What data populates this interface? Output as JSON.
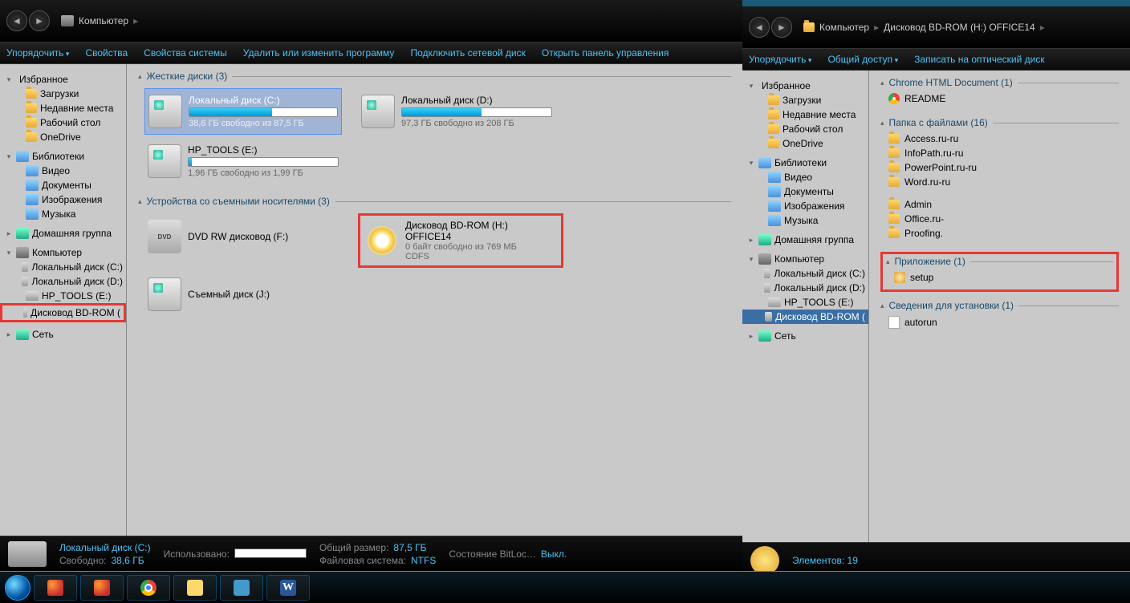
{
  "win1": {
    "breadcrumb": [
      "Компьютер"
    ],
    "toolbar": [
      "Упорядочить",
      "Свойства",
      "Свойства системы",
      "Удалить или изменить программу",
      "Подключить сетевой диск",
      "Открыть панель управления"
    ],
    "sidebar": {
      "fav_head": "Избранное",
      "fav": [
        "Загрузки",
        "Недавние места",
        "Рабочий стол",
        "OneDrive"
      ],
      "lib_head": "Библиотеки",
      "lib": [
        "Видео",
        "Документы",
        "Изображения",
        "Музыка"
      ],
      "home": "Домашняя группа",
      "comp_head": "Компьютер",
      "comp": [
        "Локальный диск (C:)",
        "Локальный диск (D:)",
        "HP_TOOLS (E:)",
        "Дисковод BD-ROM ("
      ],
      "net": "Сеть"
    },
    "groups": {
      "hdd_head": "Жесткие диски (3)",
      "dev_head": "Устройства со съемными носителями (3)"
    },
    "drives": [
      {
        "name": "Локальный диск (C:)",
        "free": "38,6 ГБ свободно из 87,5 ГБ",
        "pct": 56,
        "sel": true
      },
      {
        "name": "Локальный диск (D:)",
        "free": "97,3 ГБ свободно из 208 ГБ",
        "pct": 53
      },
      {
        "name": "HP_TOOLS (E:)",
        "free": "1,96 ГБ свободно из 1,99 ГБ",
        "pct": 2
      }
    ],
    "removable": [
      {
        "name": "DVD RW дисковод (F:)",
        "type": "dvd"
      },
      {
        "name": "Дисковод BD-ROM (H:) OFFICE14",
        "free": "0 байт свободно из 769 МБ",
        "fs": "CDFS",
        "type": "disc",
        "boxed": true
      },
      {
        "name": "Съемный диск (J:)",
        "type": "hdd"
      }
    ],
    "status": {
      "name": "Локальный диск (C:)",
      "used_k": "Использовано:",
      "free_k": "Свободно:",
      "free_v": "38,6 ГБ",
      "size_k": "Общий размер:",
      "size_v": "87,5 ГБ",
      "fs_k": "Файловая система:",
      "fs_v": "NTFS",
      "bl_k": "Состояние BitLoc…",
      "bl_v": "Выкл."
    }
  },
  "win2": {
    "breadcrumb": [
      "Компьютер",
      "Дисковод BD-ROM (H:) OFFICE14"
    ],
    "toolbar": [
      "Упорядочить",
      "Общий доступ",
      "Записать на оптический диск"
    ],
    "sidebar": {
      "fav_head": "Избранное",
      "fav": [
        "Загрузки",
        "Недавние места",
        "Рабочий стол",
        "OneDrive"
      ],
      "lib_head": "Библиотеки",
      "lib": [
        "Видео",
        "Документы",
        "Изображения",
        "Музыка"
      ],
      "home": "Домашняя группа",
      "comp_head": "Компьютер",
      "comp": [
        "Локальный диск (C:)",
        "Локальный диск (D:)",
        "HP_TOOLS (E:)",
        "Дисковод BD-ROM ("
      ],
      "net": "Сеть"
    },
    "groups": [
      {
        "head": "Chrome HTML Document (1)",
        "items": [
          {
            "n": "README",
            "ic": "chrome"
          }
        ]
      },
      {
        "head": "Папка с файлами (16)",
        "items": [
          {
            "n": "Access.ru-ru"
          },
          {
            "n": "Admin"
          },
          {
            "n": "InfoPath.ru-ru"
          },
          {
            "n": "Office.ru-"
          },
          {
            "n": "PowerPoint.ru-ru"
          },
          {
            "n": "Proofing."
          },
          {
            "n": "Word.ru-ru"
          }
        ]
      },
      {
        "head": "Приложение (1)",
        "boxed": true,
        "items": [
          {
            "n": "setup",
            "ic": "app"
          }
        ]
      },
      {
        "head": "Сведения для установки (1)",
        "items": [
          {
            "n": "autorun",
            "ic": "file"
          }
        ]
      }
    ],
    "status_text": "Элементов: 19"
  }
}
